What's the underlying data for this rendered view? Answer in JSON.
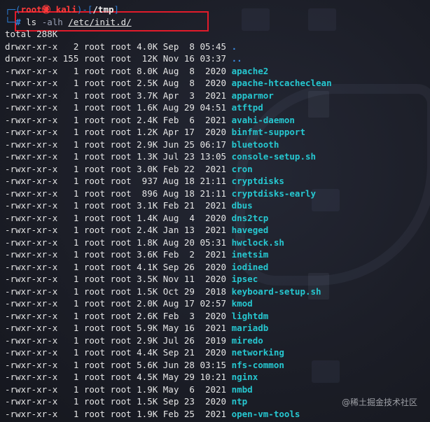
{
  "prompt": {
    "open": "┌─(",
    "user": "root㊝ kali",
    "sep": ")-[",
    "path": "/tmp",
    "close": "]",
    "line2": "└─",
    "hash": "# ",
    "cmd": "ls ",
    "flag": "-alh ",
    "arg": "/etc/init.d/"
  },
  "total": "total 288K",
  "entries": [
    {
      "meta": "drwxr-xr-x   2 root root 4.0K Sep  8 05:45 ",
      "name": ".",
      "type": "dir"
    },
    {
      "meta": "drwxr-xr-x 155 root root  12K Nov 16 03:37 ",
      "name": "..",
      "type": "dir"
    },
    {
      "meta": "-rwxr-xr-x   1 root root 8.0K Aug  8  2020 ",
      "name": "apache2",
      "type": "exec"
    },
    {
      "meta": "-rwxr-xr-x   1 root root 2.5K Aug  8  2020 ",
      "name": "apache-htcacheclean",
      "type": "exec"
    },
    {
      "meta": "-rwxr-xr-x   1 root root 3.7K Apr  3  2021 ",
      "name": "apparmor",
      "type": "exec"
    },
    {
      "meta": "-rwxr-xr-x   1 root root 1.6K Aug 29 04:51 ",
      "name": "atftpd",
      "type": "exec"
    },
    {
      "meta": "-rwxr-xr-x   1 root root 2.4K Feb  6  2021 ",
      "name": "avahi-daemon",
      "type": "exec"
    },
    {
      "meta": "-rwxr-xr-x   1 root root 1.2K Apr 17  2020 ",
      "name": "binfmt-support",
      "type": "exec"
    },
    {
      "meta": "-rwxr-xr-x   1 root root 2.9K Jun 25 06:17 ",
      "name": "bluetooth",
      "type": "exec"
    },
    {
      "meta": "-rwxr-xr-x   1 root root 1.3K Jul 23 13:05 ",
      "name": "console-setup.sh",
      "type": "exec"
    },
    {
      "meta": "-rwxr-xr-x   1 root root 3.0K Feb 22  2021 ",
      "name": "cron",
      "type": "exec"
    },
    {
      "meta": "-rwxr-xr-x   1 root root  937 Aug 18 21:11 ",
      "name": "cryptdisks",
      "type": "exec"
    },
    {
      "meta": "-rwxr-xr-x   1 root root  896 Aug 18 21:11 ",
      "name": "cryptdisks-early",
      "type": "exec"
    },
    {
      "meta": "-rwxr-xr-x   1 root root 3.1K Feb 21  2021 ",
      "name": "dbus",
      "type": "exec"
    },
    {
      "meta": "-rwxr-xr-x   1 root root 1.4K Aug  4  2020 ",
      "name": "dns2tcp",
      "type": "exec"
    },
    {
      "meta": "-rwxr-xr-x   1 root root 2.4K Jan 13  2021 ",
      "name": "haveged",
      "type": "exec"
    },
    {
      "meta": "-rwxr-xr-x   1 root root 1.8K Aug 20 05:31 ",
      "name": "hwclock.sh",
      "type": "exec"
    },
    {
      "meta": "-rwxr-xr-x   1 root root 3.6K Feb  2  2021 ",
      "name": "inetsim",
      "type": "exec"
    },
    {
      "meta": "-rwxr-xr-x   1 root root 4.1K Sep 26  2020 ",
      "name": "iodined",
      "type": "exec"
    },
    {
      "meta": "-rwxr-xr-x   1 root root 3.5K Nov 11  2020 ",
      "name": "ipsec",
      "type": "exec"
    },
    {
      "meta": "-rwxr-xr-x   1 root root 1.5K Oct 29  2018 ",
      "name": "keyboard-setup.sh",
      "type": "exec"
    },
    {
      "meta": "-rwxr-xr-x   1 root root 2.0K Aug 17 02:57 ",
      "name": "kmod",
      "type": "exec"
    },
    {
      "meta": "-rwxr-xr-x   1 root root 2.6K Feb  3  2020 ",
      "name": "lightdm",
      "type": "exec"
    },
    {
      "meta": "-rwxr-xr-x   1 root root 5.9K May 16  2021 ",
      "name": "mariadb",
      "type": "exec"
    },
    {
      "meta": "-rwxr-xr-x   1 root root 2.9K Jul 26  2019 ",
      "name": "miredo",
      "type": "exec"
    },
    {
      "meta": "-rwxr-xr-x   1 root root 4.4K Sep 21  2020 ",
      "name": "networking",
      "type": "exec"
    },
    {
      "meta": "-rwxr-xr-x   1 root root 5.6K Jun 28 03:15 ",
      "name": "nfs-common",
      "type": "exec"
    },
    {
      "meta": "-rwxr-xr-x   1 root root 4.5K May 29 10:21 ",
      "name": "nginx",
      "type": "exec"
    },
    {
      "meta": "-rwxr-xr-x   1 root root 1.9K May  6  2021 ",
      "name": "nmbd",
      "type": "exec"
    },
    {
      "meta": "-rwxr-xr-x   1 root root 1.5K Sep 23  2020 ",
      "name": "ntp",
      "type": "exec"
    },
    {
      "meta": "-rwxr-xr-x   1 root root 1.9K Feb 25  2021 ",
      "name": "open-vm-tools",
      "type": "exec"
    }
  ],
  "watermark": "@稀土掘金技术社区",
  "colors": {
    "background": "#1c1e27",
    "prompt_blue": "#2f7fd6",
    "prompt_red": "#ff3b3b",
    "exec_cyan": "#26c7d0",
    "dir_blue": "#3b8fe8",
    "highlight_red": "#e11b2a"
  }
}
